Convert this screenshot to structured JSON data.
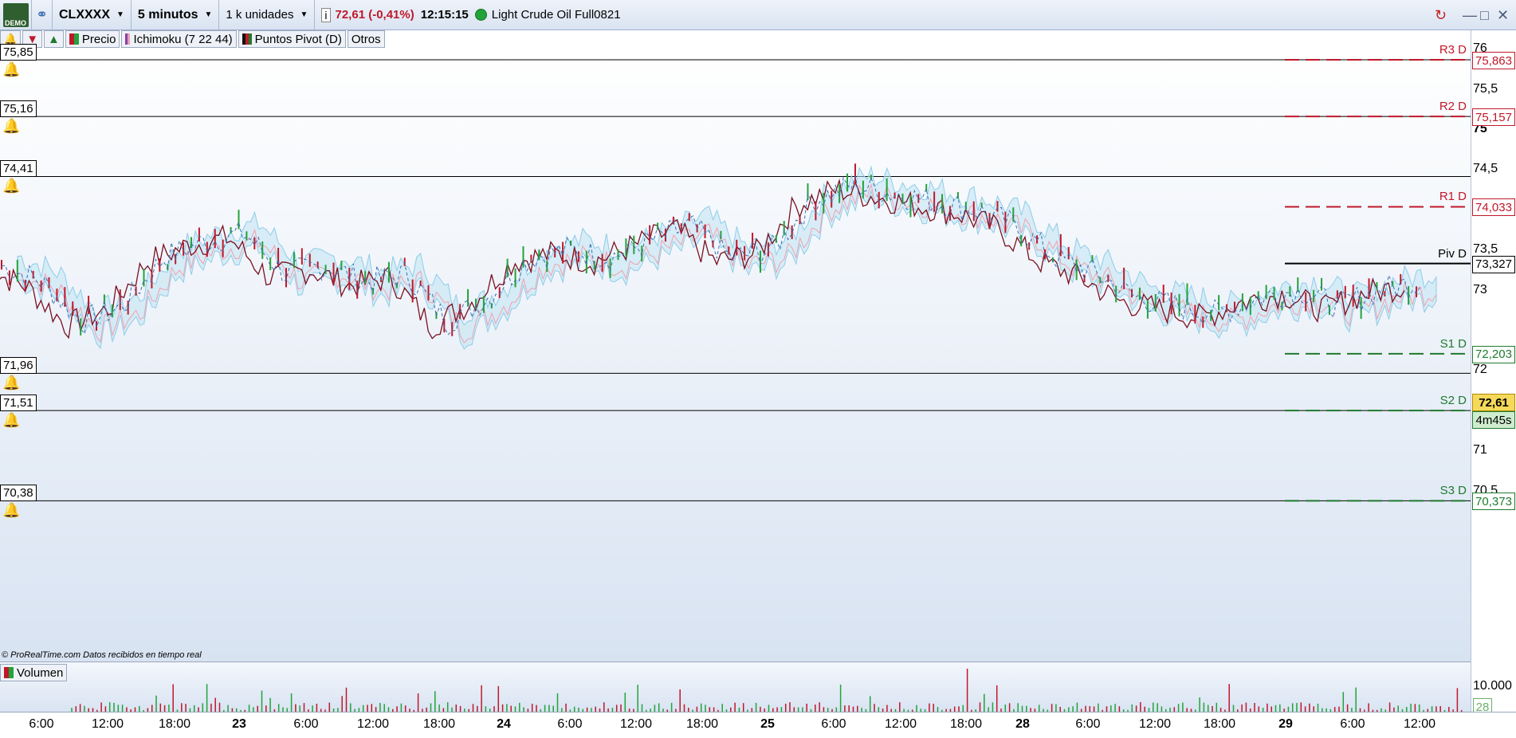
{
  "toolbar": {
    "demo_label": "DEMO",
    "instrument": "CLXXXX",
    "timeframe": "5 minutos",
    "units": "1 k unidades",
    "price_change": "72,61 (-0,41%)",
    "time": "12:15:15",
    "instrument_name": "Light Crude Oil Full0821"
  },
  "legend": {
    "price": "Precio",
    "ichimoku": "Ichimoku (7 22 44)",
    "pivots": "Puntos Pivot (D)",
    "others": "Otros",
    "volume": "Volumen"
  },
  "credit": "© ProRealTime.com  Datos recibidos en tiempo real",
  "hlines": [
    {
      "label": "75,85",
      "value": 75.863
    },
    {
      "label": "75,16",
      "value": 75.157
    },
    {
      "label": "74,41",
      "value": 74.41
    },
    {
      "label": "71,96",
      "value": 71.96
    },
    {
      "label": "71,51",
      "value": 71.497
    },
    {
      "label": "70,38",
      "value": 70.373
    }
  ],
  "pivots": [
    {
      "name": "R3 D",
      "box": "75,863",
      "value": 75.863,
      "color": "#c0182a"
    },
    {
      "name": "R2 D",
      "box": "75,157",
      "value": 75.157,
      "color": "#c0182a"
    },
    {
      "name": "R1 D",
      "box": "74,033",
      "value": 74.033,
      "color": "#c0182a"
    },
    {
      "name": "Piv D",
      "box": "73,327",
      "value": 73.327,
      "color": "#000000"
    },
    {
      "name": "S1 D",
      "box": "72,203",
      "value": 72.203,
      "color": "#1f7a2e"
    },
    {
      "name": "S2 D",
      "box": "71,497",
      "value": 71.497,
      "color": "#1f7a2e"
    },
    {
      "name": "S3 D",
      "box": "70,373",
      "value": 70.373,
      "color": "#1f7a2e"
    }
  ],
  "yaxis": [
    "76",
    "75,5",
    "75",
    "74,5",
    "73,5",
    "73",
    "72",
    "71",
    "70,5"
  ],
  "last_price": "72,61",
  "countdown": "4m45s",
  "volume_axis": "10.000",
  "volume_last": "28",
  "xaxis": [
    "6:00",
    "12:00",
    "18:00",
    "23",
    "6:00",
    "12:00",
    "18:00",
    "24",
    "6:00",
    "12:00",
    "18:00",
    "25",
    "6:00",
    "12:00",
    "18:00",
    "28",
    "6:00",
    "12:00",
    "18:00",
    "29",
    "6:00",
    "12:00"
  ],
  "chart_data": {
    "type": "line",
    "title": "CLXXXX 5 minutos",
    "ylim": [
      70.2,
      76.1
    ],
    "series": [
      {
        "name": "Precio",
        "values": [
          73.3,
          73.1,
          72.6,
          72.8,
          73.4,
          73.6,
          73.7,
          73.2,
          73.3,
          73.1,
          73.2,
          72.6,
          72.9,
          73.4,
          73.5,
          73.4,
          73.6,
          73.8,
          73.4,
          73.5,
          74.1,
          74.3,
          74.2,
          74.1,
          74.0,
          73.8,
          73.4,
          73.2,
          72.9,
          72.8,
          72.7,
          72.9,
          73.0,
          72.8,
          73.0,
          73.1
        ]
      }
    ]
  }
}
